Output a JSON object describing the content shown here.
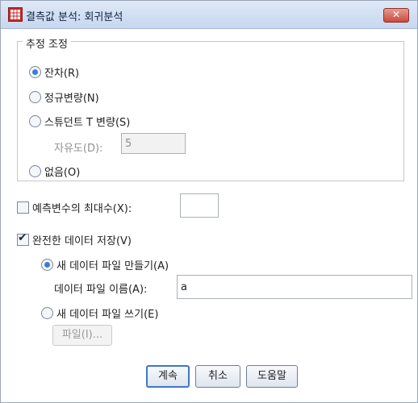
{
  "window": {
    "title": "결측값 분석: 회귀분석",
    "close": "✕"
  },
  "estimation": {
    "legend": "추정 조정",
    "residual": "잔차(R)",
    "normal_variate": "정규변량(N)",
    "student_t": "스튜던트 T 변량(S)",
    "df_label": "자유도(D):",
    "df_value": "5",
    "none": "없음(O)",
    "selected": "residual"
  },
  "max_predictors": {
    "label": "예측변수의 최대수(X):",
    "value": "",
    "checked": false
  },
  "save_complete": {
    "label": "완전한 데이터 저장(V)",
    "checked": true,
    "new_file_label": "새 데이터 파일 만들기(A)",
    "file_name_label": "데이터 파일 이름(A):",
    "file_name_value": "a",
    "write_file_label": "새 데이터 파일 쓰기(E)",
    "file_button": "파일(I)...",
    "selected": "new_file"
  },
  "buttons": {
    "continue": "계속",
    "cancel": "취소",
    "help": "도움말"
  }
}
